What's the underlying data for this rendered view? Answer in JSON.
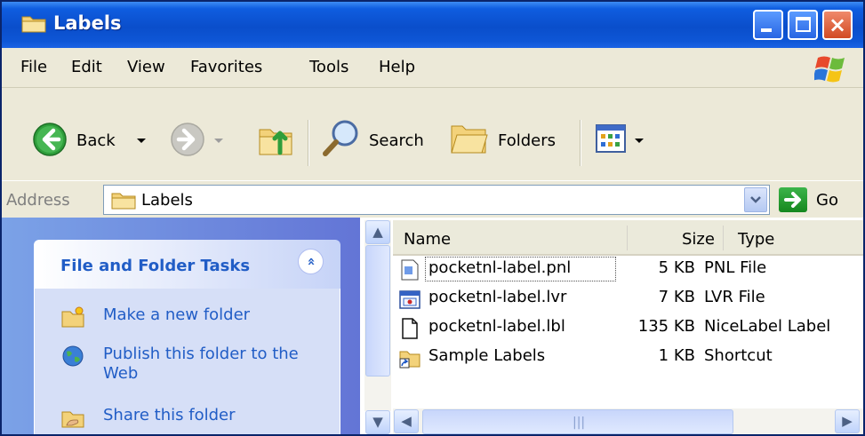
{
  "window": {
    "title": "Labels",
    "controls": {
      "minimize": "minimize",
      "maximize": "maximize",
      "close": "×"
    },
    "accent": "#0a4ecb"
  },
  "menu": [
    "File",
    "Edit",
    "View",
    "Favorites",
    "Tools",
    "Help"
  ],
  "toolbar": {
    "back_label": "Back",
    "search_label": "Search",
    "folders_label": "Folders"
  },
  "address": {
    "label": "Address",
    "value": "Labels",
    "go_label": "Go"
  },
  "tasks_panel": {
    "header": "File and Folder Tasks",
    "collapse_glyph": "»",
    "items": [
      {
        "label": "Make a new folder",
        "icon": "new-folder-icon"
      },
      {
        "label": "Publish this folder to the Web",
        "icon": "globe-icon"
      },
      {
        "label": "Share this folder",
        "icon": "share-folder-icon"
      }
    ]
  },
  "file_list": {
    "columns": [
      "Name",
      "Size",
      "Type"
    ],
    "rows": [
      {
        "name": "pocketnl-label.pnl",
        "size": "5 KB",
        "type": "PNL File",
        "icon": "pnl-file-icon",
        "focused": true
      },
      {
        "name": "pocketnl-label.lvr",
        "size": "7 KB",
        "type": "LVR File",
        "icon": "lvr-file-icon",
        "focused": false
      },
      {
        "name": "pocketnl-label.lbl",
        "size": "135 KB",
        "type": "NiceLabel Label",
        "icon": "generic-file-icon",
        "focused": false
      },
      {
        "name": "Sample Labels",
        "size": "1 KB",
        "type": "Shortcut",
        "icon": "folder-shortcut-icon",
        "focused": false
      }
    ]
  },
  "scrollbar": {
    "up": "▲",
    "down": "▼",
    "left": "◀",
    "right": "▶",
    "grip": "|||"
  }
}
